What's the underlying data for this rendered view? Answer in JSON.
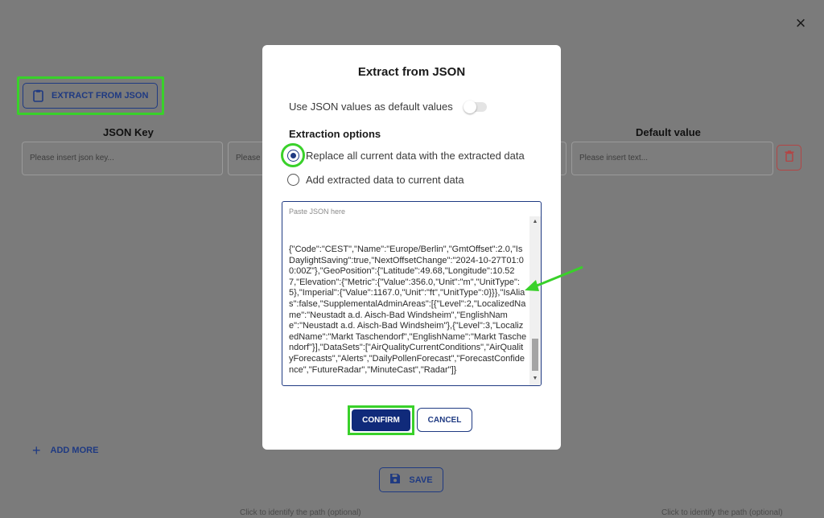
{
  "background": {
    "close_glyph": "×",
    "extract_button_label": "EXTRACT FROM JSON",
    "columns": {
      "json_key_header": "JSON Key",
      "default_value_header": "Default value"
    },
    "inputs": {
      "json_key_placeholder": "Please insert json key...",
      "second_placeholder": "Please",
      "default_value_placeholder": "Please insert text..."
    },
    "add_more_label": "ADD MORE",
    "save_label": "SAVE",
    "bottom_hint_left": "Click to identify the path (optional)",
    "bottom_hint_right": "Click to identify the path (optional)"
  },
  "modal": {
    "title": "Extract from JSON",
    "toggle_label": "Use JSON values as default values",
    "toggle_on": false,
    "section_label": "Extraction options",
    "options": [
      {
        "label": "Replace all current data with the extracted data",
        "selected": true
      },
      {
        "label": "Add extracted data to current data",
        "selected": false
      }
    ],
    "json_placeholder": "Paste JSON here",
    "json_value": "{\"Code\":\"CEST\",\"Name\":\"Europe/Berlin\",\"GmtOffset\":2.0,\"IsDaylightSaving\":true,\"NextOffsetChange\":\"2024-10-27T01:00:00Z\"},\"GeoPosition\":{\"Latitude\":49.68,\"Longitude\":10.527,\"Elevation\":{\"Metric\":{\"Value\":356.0,\"Unit\":\"m\",\"UnitType\":5},\"Imperial\":{\"Value\":1167.0,\"Unit\":\"ft\",\"UnitType\":0}}},\"IsAlias\":false,\"SupplementalAdminAreas\":[{\"Level\":2,\"LocalizedName\":\"Neustadt a.d. Aisch-Bad Windsheim\",\"EnglishName\":\"Neustadt a.d. Aisch-Bad Windsheim\"},{\"Level\":3,\"LocalizedName\":\"Markt Taschendorf\",\"EnglishName\":\"Markt Taschendorf\"}],\"DataSets\":[\"AirQualityCurrentConditions\",\"AirQualityForecasts\",\"Alerts\",\"DailyPollenForecast\",\"ForecastConfidence\",\"FutureRadar\",\"MinuteCast\",\"Radar\"]}",
    "confirm_label": "CONFIRM",
    "cancel_label": "CANCEL"
  },
  "colors": {
    "accent": "#1f3a82",
    "confirm_bg": "#102a7a",
    "annotation_green": "#39d12a",
    "delete_red": "#b24545"
  }
}
